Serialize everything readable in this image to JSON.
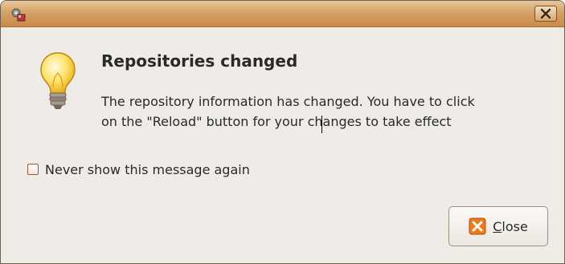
{
  "window": {
    "title": ""
  },
  "dialog": {
    "heading": "Repositories changed",
    "message_lines": [
      "The repository information has changed. You have to click",
      "on the \"Reload\" button for your changes to take effect"
    ],
    "checkbox_label": "Never show this message again",
    "checkbox_checked": false,
    "close_button_label_mnemonic": "C",
    "close_button_label_rest": "lose",
    "icon": "lightbulb-icon"
  },
  "titlebar": {
    "app_icon": "package-manager-icon",
    "close_icon": "close-icon"
  },
  "colors": {
    "titlebar": "#d6a267",
    "background": "#efebe7",
    "close_icon_orange": "#f07a1a"
  }
}
